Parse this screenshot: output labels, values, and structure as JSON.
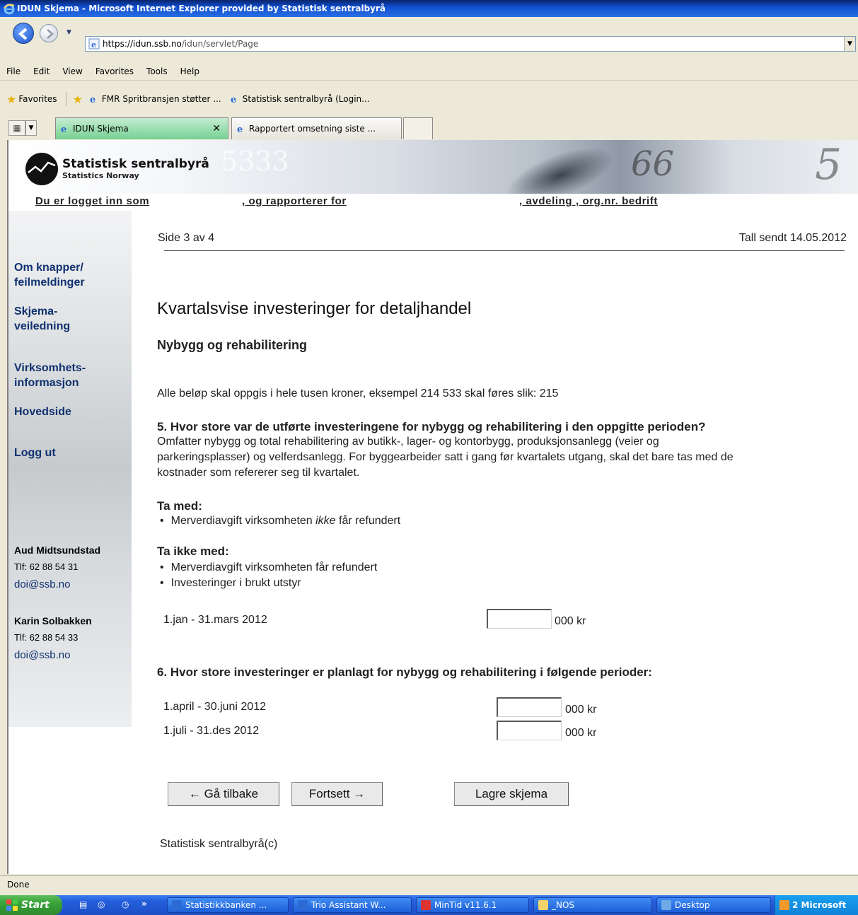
{
  "window": {
    "title": "IDUN Skjema - Microsoft Internet Explorer provided by Statistisk sentralbyrå"
  },
  "address": {
    "url_host": "https://idun.ssb.no",
    "url_path": "/idun/servlet/Page"
  },
  "menu": [
    "File",
    "Edit",
    "View",
    "Favorites",
    "Tools",
    "Help"
  ],
  "favorites": {
    "label": "Favorites",
    "items": [
      "FMR  Spritbransjen støtter ...",
      "Statistisk sentralbyrå (Login..."
    ]
  },
  "tabs": {
    "active": "IDUN Skjema",
    "inactive": "Rapportert omsetning siste ..."
  },
  "banner": {
    "org_name": "Statistisk sentralbyrå",
    "org_sub": "Statistics Norway"
  },
  "loginbar": {
    "logged_in": "Du er logget inn som",
    "reporting_for": ", og rapporterer for",
    "department": ", avdeling , org.nr. bedrift"
  },
  "sidebar": {
    "links": [
      {
        "line1": "Om knapper/",
        "line2": "feilmeldinger"
      },
      {
        "line1": "Skjema-",
        "line2": "veiledning"
      },
      {
        "line1": "Virksomhets-",
        "line2": "informasjon"
      },
      {
        "line1": "Hovedside",
        "line2": ""
      },
      {
        "line1": "Logg ut",
        "line2": ""
      }
    ],
    "contacts": [
      {
        "name": "Aud Midtsundstad",
        "phone": "Tlf:  62 88 54 31",
        "email": "doi@ssb.no"
      },
      {
        "name": "Karin Solbakken",
        "phone": "Tlf:  62 88 54 33",
        "email": "doi@ssb.no"
      }
    ]
  },
  "page": {
    "page_info": "Side 3 av 4",
    "sent_info": "Tall sendt 14.05.2012",
    "title": "Kvartalsvise investeringer for detaljhandel",
    "subtitle": "Nybygg og rehabilitering",
    "note": "Alle beløp skal oppgis i hele tusen kroner, eksempel 214 533 skal føres slik: 215",
    "q5": {
      "question": "5. Hvor store var de utførte investeringene for nybygg og rehabilitering i den oppgitte perioden?",
      "desc1": "Omfatter nybygg og total rehabilitering av butikk-, lager- og kontorbygg, produksjonsanlegg (veier og",
      "desc2": "parkeringsplasser) og velferdsanlegg. For byggearbeider satt i gang før kvartalets utgang, skal det bare tas med de",
      "desc3": "kostnader som refererer seg til kvartalet.",
      "include_label": "Ta med:",
      "include_pre": "Merverdiavgift virksomheten ",
      "include_em": "ikke",
      "include_post": " får refundert",
      "exclude_label": "Ta ikke med:",
      "exclude_items": [
        "Merverdiavgift virksomheten får refundert",
        "Investeringer i brukt utstyr"
      ],
      "period": "1.jan - 31.mars 2012",
      "value": "",
      "unit": "000 kr"
    },
    "q6": {
      "question": "6. Hvor store investeringer er planlagt for nybygg og rehabilitering i følgende perioder:",
      "rows": [
        {
          "period": "1.april - 30.juni 2012",
          "value": "",
          "unit": "000 kr"
        },
        {
          "period": "1.juli - 31.des 2012",
          "value": "",
          "unit": "000 kr"
        }
      ]
    },
    "buttons": {
      "back": "← Gå tilbake",
      "next": "Fortsett →",
      "save": "Lagre skjema"
    },
    "footer": "Statistisk sentralbyrå(c)"
  },
  "status": {
    "text": "Done"
  },
  "taskbar": {
    "start": "Start",
    "chevron": "»",
    "tasks": [
      "Statistikkbanken ...",
      "Trio Assistant W...",
      "MinTid v11.6.1",
      "_NOS",
      "Desktop"
    ],
    "tray": "2 Microsoft"
  }
}
